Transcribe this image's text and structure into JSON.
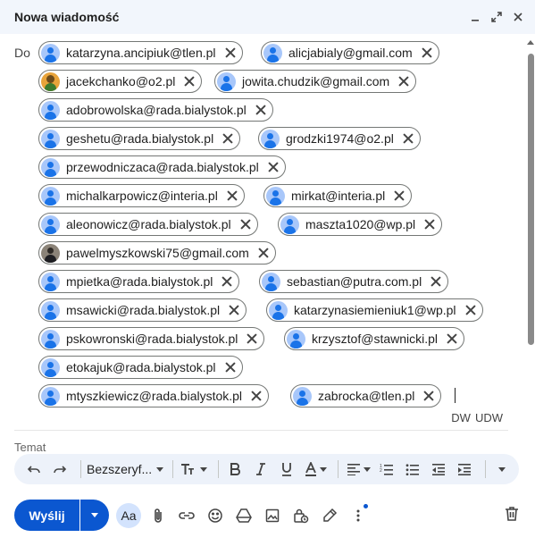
{
  "window": {
    "title": "Nowa wiadomość"
  },
  "to": {
    "label": "Do",
    "recipients": [
      "katarzyna.ancipiuk@tlen.pl",
      "alicjabialy@gmail.com",
      "jacekchanko@o2.pl",
      "jowita.chudzik@gmail.com",
      "adobrowolska@rada.bialystok.pl",
      "geshetu@rada.bialystok.pl",
      "grodzki1974@o2.pl",
      "przewodniczaca@rada.bialystok.pl",
      "michalkarpowicz@interia.pl",
      "mirkat@interia.pl",
      "aleonowicz@rada.bialystok.pl",
      "maszta1020@wp.pl",
      "pawelmyszkowski75@gmail.com",
      "mpietka@rada.bialystok.pl",
      "sebastian@putra.com.pl",
      "msawicki@rada.bialystok.pl",
      "katarzynasiemieniuk1@wp.pl",
      "pskowronski@rada.bialystok.pl",
      "krzysztof@stawnicki.pl",
      "etokajuk@rada.bialystok.pl",
      "mtyszkiewicz@rada.bialystok.pl",
      "zabrocka@tlen.pl"
    ],
    "cc_label": "DW",
    "bcc_label": "UDW"
  },
  "subject": {
    "placeholder": "Temat"
  },
  "toolbar": {
    "font_name": "Bezszeryf..."
  },
  "actions": {
    "send_label": "Wyślij",
    "format_label": "Aa"
  }
}
